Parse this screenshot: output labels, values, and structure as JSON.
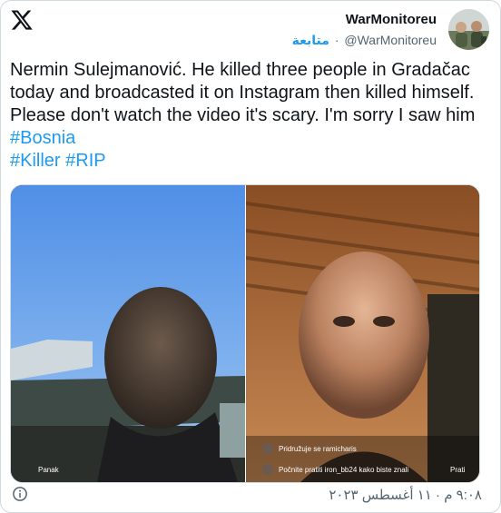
{
  "header": {
    "display_name": "WarMonitoreu",
    "handle": "@WarMonitoreu",
    "separator": "·",
    "follow_label": "متابعة"
  },
  "tweet": {
    "text": "Nermin Sulejmanović. He killed three people in Gradačac today and broadcasted it on Instagram then killed himself. Please don't watch the video it's scary. I'm sorry I saw him",
    "hashtags": [
      "#Bosnia",
      "#Killer",
      "#RIP"
    ]
  },
  "media": {
    "left_frame": {
      "overlay_username": "Panak"
    },
    "right_frame": {
      "overlay_comment_1": "Pridružuje se ramicharis",
      "overlay_comment_2": "Počnite pratiti iron_bb24 kako biste znali",
      "overlay_action": "Prati"
    }
  },
  "footer": {
    "timestamp": "٩:٠٨ م · ١١ أغسطس ٢٠٢٣"
  },
  "colors": {
    "accent": "#1d9bf0",
    "text_primary": "#0f1419",
    "text_secondary": "#536471",
    "border": "#cfd9de"
  },
  "icons": [
    "x-logo-icon",
    "info-icon"
  ]
}
